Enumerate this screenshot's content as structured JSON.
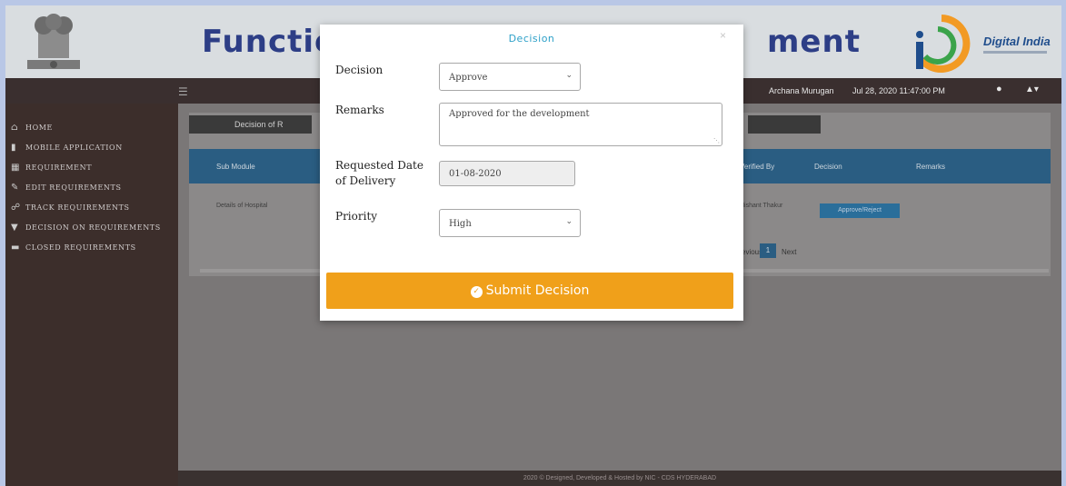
{
  "header": {
    "title_left": "Functio",
    "title_right": "ment",
    "logo_text": "Digital India"
  },
  "topnav": {
    "toggle_icon": "menu-icon",
    "user_name": "Archana Murugan",
    "datetime": "Jul 28, 2020 11:47:00 PM",
    "notification_icon": "bell-icon",
    "account_icon": "user-icon"
  },
  "sidebar": {
    "items": [
      {
        "icon": "home-icon",
        "label": "HOME"
      },
      {
        "icon": "mobile-icon",
        "label": "MOBILE APPLICATION"
      },
      {
        "icon": "requirement-icon",
        "label": "REQUIREMENT"
      },
      {
        "icon": "edit-icon",
        "label": "EDIT REQUIREMENTS"
      },
      {
        "icon": "track-icon",
        "label": "TRACK REQUIREMENTS"
      },
      {
        "icon": "filter-icon",
        "label": "DECISION ON REQUIREMENTS"
      },
      {
        "icon": "folder-icon",
        "label": "CLOSED REQUIREMENTS"
      }
    ]
  },
  "panel": {
    "tab_label": "Decision of R"
  },
  "table": {
    "headers": [
      "Sub Module",
      "Verified By",
      "Decision",
      "Remarks"
    ],
    "rows": [
      {
        "sub_module": "Details of Hospital",
        "verified_by": "Nishant Thakur",
        "action": "Approve/Reject"
      }
    ]
  },
  "pager": {
    "prev": "Previous",
    "current": "1",
    "next": "Next"
  },
  "footer": {
    "text": "2020 © Designed, Developed & Hosted by NIC - CDS HYDERABAD"
  },
  "modal": {
    "title": "Decision",
    "close": "×",
    "decision_label": "Decision",
    "decision_value": "Approve",
    "remarks_label": "Remarks",
    "remarks_value": "Approved for the development",
    "date_label_1": "Requested Date",
    "date_label_2": "of Delivery",
    "date_value": "01-08-2020",
    "priority_label": "Priority",
    "priority_value": "High",
    "submit_label": "Submit Decision"
  }
}
